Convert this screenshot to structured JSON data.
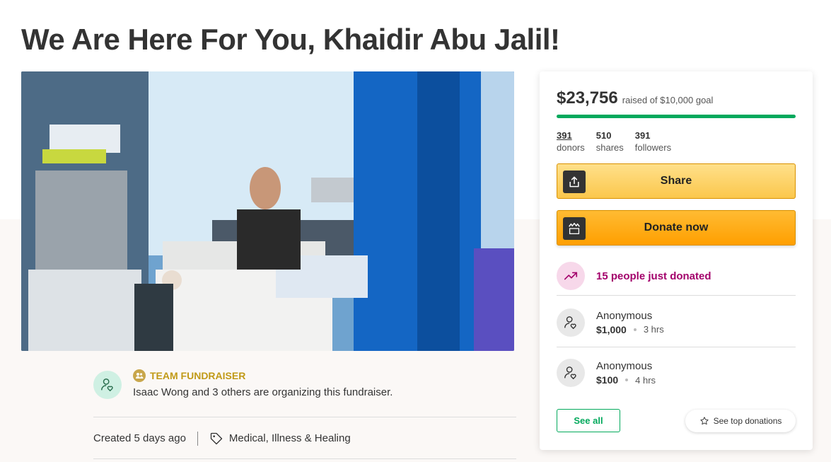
{
  "page": {
    "title": "We Are Here For You, Khaidir Abu Jalil!"
  },
  "organizer": {
    "team_label": "TEAM FUNDRAISER",
    "text": "Isaac Wong and 3 others are organizing this fundraiser."
  },
  "meta": {
    "created": "Created 5 days ago",
    "category": "Medical, Illness & Healing"
  },
  "donation_card": {
    "amount": "$23,756",
    "goal_text": "raised of $10,000 goal",
    "progress_fraction": 1.0,
    "stats": [
      {
        "number": "391",
        "label": "donors"
      },
      {
        "number": "510",
        "label": "shares"
      },
      {
        "number": "391",
        "label": "followers"
      }
    ],
    "share_label": "Share",
    "donate_label": "Donate now",
    "trend_text": "15 people just donated",
    "donations": [
      {
        "name": "Anonymous",
        "amount": "$1,000",
        "time": "3 hrs"
      },
      {
        "name": "Anonymous",
        "amount": "$100",
        "time": "4 hrs"
      }
    ],
    "see_all_label": "See all",
    "see_top_label": "See top donations"
  },
  "colors": {
    "brand_green": "#02a95c",
    "donate_orange": "#ff9f00",
    "trend_magenta": "#a3006b",
    "team_gold": "#c19a17"
  },
  "icons": {
    "share": "share-icon",
    "donate": "gofundme-logo-icon",
    "trend": "trending-up-icon",
    "donor": "user-heart-icon",
    "tag": "tag-icon",
    "star": "star-icon"
  }
}
